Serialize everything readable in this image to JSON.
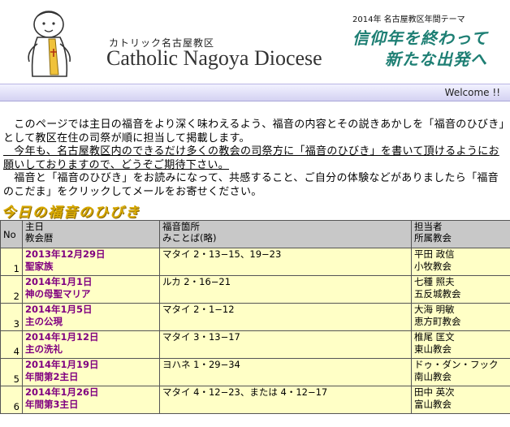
{
  "header": {
    "diocese_jp": "カトリック名古屋教区",
    "diocese_en": "Catholic Nagoya Diocese",
    "theme_year": "2014年 名古屋教区年間テーマ",
    "theme_line1": "信仰年を終わって",
    "theme_line2": "新たな出発へ"
  },
  "welcome": "Welcome !!",
  "intro": {
    "p1": "　このページでは主日の福音をより深く味わえるよう、福音の内容とその説きあかしを「福音のひびき」として教区在住の司祭が順に担当して掲載します。",
    "p2_underlined": "　今年も、名古屋教区内のできるだけ多くの教会の司祭方に「福音のひびき」を書いて頂けるようにお願いしておりますので、どうぞご期待下さい。",
    "p3": "　福音と「福音のひびき」をお読みになって、共感すること、ご自分の体験などがありましたら「福音のこだま」をクリックしてメールをお寄せください。"
  },
  "section_title": "今日の福音のひびき",
  "table": {
    "headers": {
      "no": "No",
      "day_line1": "主日",
      "day_line2": "教会暦",
      "ref_line1": "福音箇所",
      "ref_line2": "みことば(略)",
      "priest_line1": "担当者",
      "priest_line2": "所属教会"
    },
    "rows": [
      {
        "no": "1",
        "date": "2013年12月29日",
        "feast": "聖家族",
        "ref": "マタイ 2・13−15、19−23",
        "priest": "平田 政信",
        "church": "小牧教会"
      },
      {
        "no": "2",
        "date": "2014年1月1日",
        "feast": "神の母聖マリア",
        "ref": "ルカ 2・16−21",
        "priest": "七種 照夫",
        "church": "五反城教会"
      },
      {
        "no": "3",
        "date": "2014年1月5日",
        "feast": "主の公現",
        "ref": "マタイ 2・1−12",
        "priest": "大海 明敏",
        "church": "恵方町教会"
      },
      {
        "no": "4",
        "date": "2014年1月12日",
        "feast": "主の洗礼",
        "ref": "マタイ 3・13−17",
        "priest": "椎尾 匡文",
        "church": "東山教会"
      },
      {
        "no": "5",
        "date": "2014年1月19日",
        "feast": "年間第2主日",
        "ref": "ヨハネ 1・29−34",
        "priest": "ドゥ・ダン・フック",
        "church": "南山教会"
      },
      {
        "no": "6",
        "date": "2014年1月26日",
        "feast": "年間第3主日",
        "ref": "マタイ 4・12−23、または 4・12−17",
        "priest": "田中 英次",
        "church": "富山教会"
      }
    ]
  },
  "colors": {
    "theme_green": "#1e7f74",
    "link_purple": "#800080",
    "row_yellow": "#ffffc6",
    "header_gray": "#c8c8c8",
    "welcome_bar": "#d4d2f2",
    "section_gold": "#d8a900"
  }
}
